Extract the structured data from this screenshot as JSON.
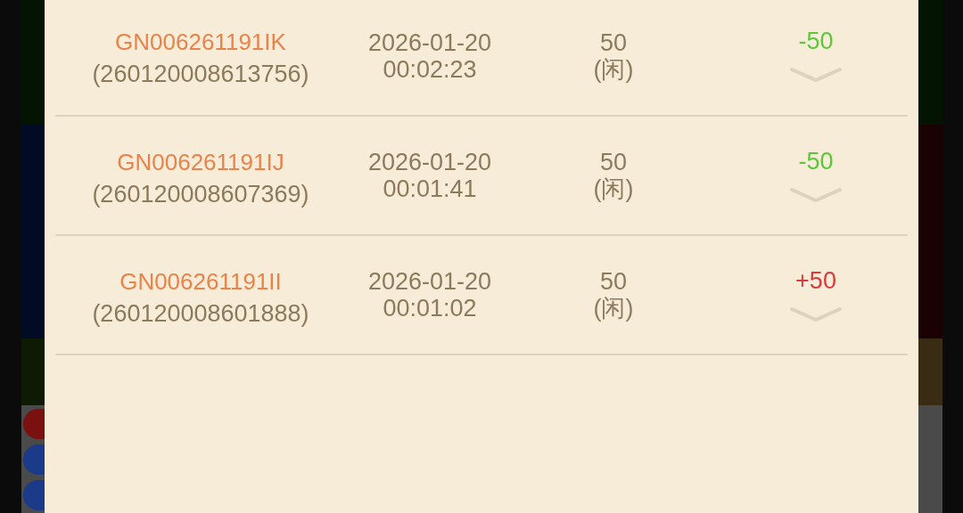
{
  "records": [
    {
      "order_id": "GN006261191IK",
      "serial": "(260120008613756)",
      "date": "2026-01-20",
      "time": "00:02:23",
      "bet": "50",
      "side": "(闲)",
      "result": "-50",
      "color": "#5dc63a"
    },
    {
      "order_id": "GN006261191IJ",
      "serial": "(260120008607369)",
      "date": "2026-01-20",
      "time": "00:01:41",
      "bet": "50",
      "side": "(闲)",
      "result": "-50",
      "color": "#5dc63a"
    },
    {
      "order_id": "GN006261191II",
      "serial": "(260120008601888)",
      "date": "2026-01-20",
      "time": "00:01:02",
      "bet": "50",
      "side": "(闲)",
      "result": "+50",
      "color": "#d93a3a"
    }
  ]
}
